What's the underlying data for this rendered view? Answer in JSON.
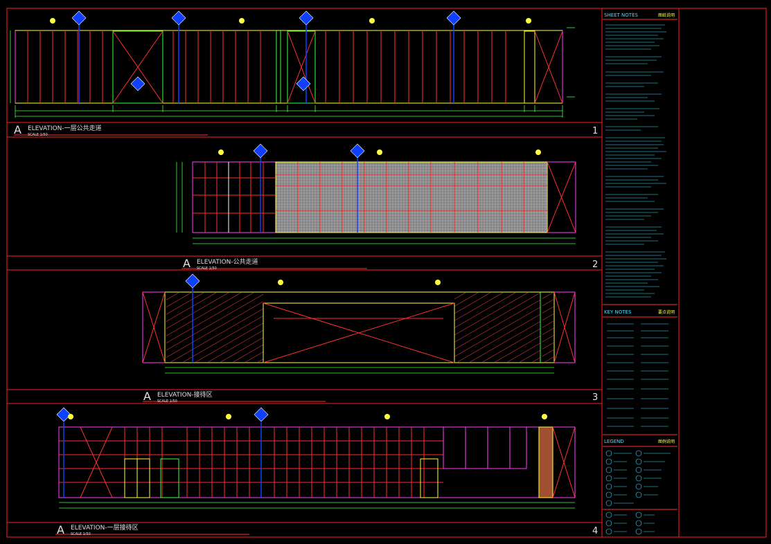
{
  "colors": {
    "background": "#000000",
    "frame": "#ff2020",
    "elevation_line": "#ffff40",
    "wall_panel": "#ff3030",
    "dim_line": "#40ff40",
    "marker": "#1040ff",
    "text": "#e0e0e0",
    "notes_text": "#40e0ff",
    "hatch": "#a0a0a0",
    "magenta": "#ff40ff"
  },
  "elevations": [
    {
      "letter": "A",
      "title": "ELEVATION-一层公共走道",
      "scale": "SCALE 1/50",
      "number": "1"
    },
    {
      "letter": "A",
      "title": "ELEVATION-公共走道",
      "scale": "SCALE 1/50",
      "number": "2"
    },
    {
      "letter": "A",
      "title": "ELEVATION-接待区",
      "scale": "SCALE 1/50",
      "number": "3"
    },
    {
      "letter": "A",
      "title": "ELEVATION-一层接待区",
      "scale": "SCALE 1/50",
      "number": "4"
    }
  ],
  "notes_panel": {
    "sheet_notes_title": "SHEET NOTES",
    "sheet_notes_title_cn": "图纸说明",
    "key_notes_title": "KEY NOTES",
    "key_notes_title_cn": "要点说明",
    "legend_title": "LEGEND",
    "legend_title_cn": "图例说明"
  }
}
